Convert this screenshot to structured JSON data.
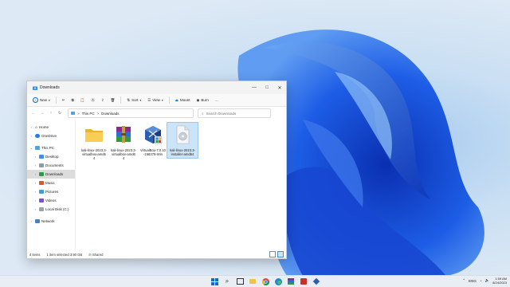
{
  "window": {
    "tab_title": "Downloads",
    "controls": {
      "minimize": "—",
      "maximize": "□",
      "close": "✕"
    }
  },
  "toolbar": {
    "new_label": "New",
    "sort_label": "Sort",
    "view_label": "View",
    "mount_label": "Mount",
    "burn_label": "Burn",
    "more_label": "..."
  },
  "address": {
    "segments": [
      "This PC",
      "Downloads"
    ],
    "separator": ">",
    "search_placeholder": "Search Downloads"
  },
  "nav": {
    "items": [
      {
        "label": "Home",
        "icon": "home-icon"
      },
      {
        "label": "OneDrive",
        "icon": "onedrive-icon"
      },
      {
        "label": "This PC",
        "icon": "computer-icon"
      },
      {
        "label": "Desktop",
        "icon": "desktop-folder-icon"
      },
      {
        "label": "Documents",
        "icon": "documents-folder-icon"
      },
      {
        "label": "Downloads",
        "icon": "downloads-folder-icon"
      },
      {
        "label": "Music",
        "icon": "music-folder-icon"
      },
      {
        "label": "Pictures",
        "icon": "pictures-folder-icon"
      },
      {
        "label": "Videos",
        "icon": "videos-folder-icon"
      },
      {
        "label": "Local Disk (C:)",
        "icon": "drive-icon"
      },
      {
        "label": "Network",
        "icon": "network-icon"
      }
    ]
  },
  "files": [
    {
      "line1": "kali-linux-2023.3-",
      "line2": "virtualbox-amd6",
      "line3": "4",
      "icon": "folder-icon"
    },
    {
      "line1": "kali-linux-2023.3-",
      "line2": "virtualbox-amd6",
      "line3": "4",
      "icon": "winrar-archive-icon"
    },
    {
      "line1": "VirtualBox-7.0.10",
      "line2": "-158379-Win",
      "line3": "",
      "icon": "virtualbox-installer-icon"
    },
    {
      "line1": "kali-linux-2023.3-",
      "line2": "installer-amd64",
      "line3": "",
      "icon": "disc-image-icon"
    }
  ],
  "status": {
    "item_count": "4 items",
    "selection": "1 item selected  3.90 GB",
    "shared": "Shared"
  },
  "taskbar": {
    "tray_lang": "ENG",
    "time": "1:59 AM",
    "date": "8/24/2023"
  },
  "colors": {
    "accent": "#0067c0",
    "folder": "#f4c542",
    "wallpaper_blue": "#1a4fd6"
  }
}
